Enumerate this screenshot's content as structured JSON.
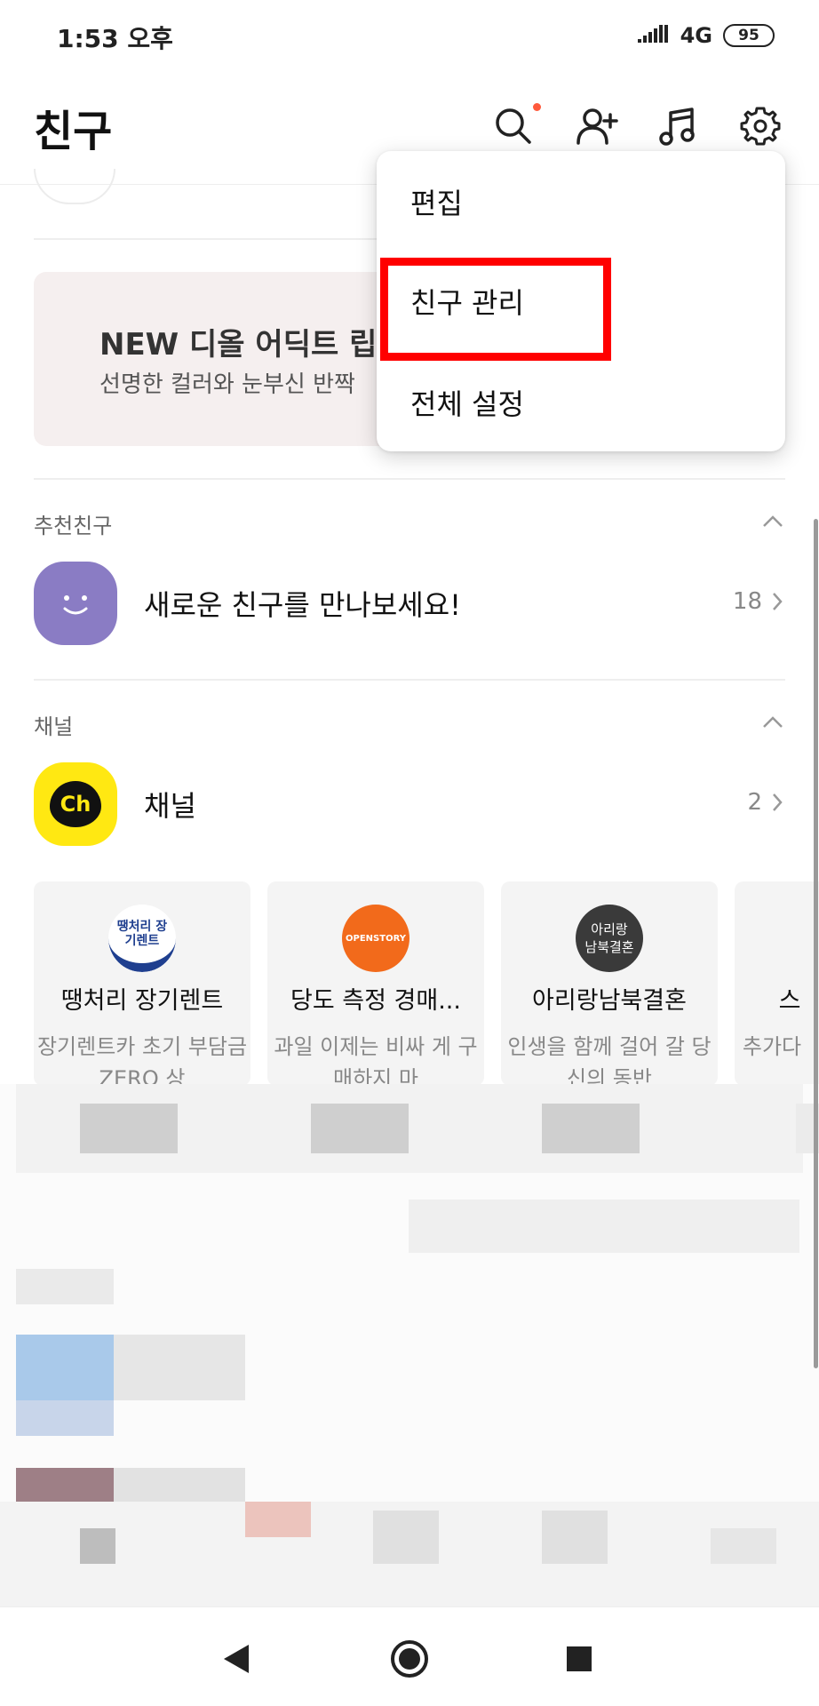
{
  "status_bar": {
    "time": "1:53 오후",
    "network": "4G",
    "battery": "95"
  },
  "header": {
    "title": "친구"
  },
  "banner": {
    "title": "NEW 디올 어딕트 립스",
    "subtitle": "선명한 컬러와 눈부신 반짝"
  },
  "recommended": {
    "section_title": "추천친구",
    "label": "새로운 친구를 만나보세요!",
    "count": "18"
  },
  "channel": {
    "section_title": "채널",
    "label": "채널",
    "count": "2",
    "avatar_text": "Ch"
  },
  "channel_cards": [
    {
      "name": "땡처리 장기렌트",
      "desc": "장기렌트카 초기 부담금 ZERO 상",
      "logo_text": "땡처리 장기렌트"
    },
    {
      "name": "당도 측정 경매...",
      "desc": "과일 이제는 비싸 게 구매하지 마",
      "logo_text": "OPENSTORY"
    },
    {
      "name": "아리랑남북결혼",
      "desc": "인생을 함께 걸어 갈 당신의 동반",
      "logo_text": "아리랑 남북결혼"
    },
    {
      "name": "스",
      "desc": "추가다",
      "logo_text": ""
    }
  ],
  "popup_menu": {
    "items": [
      "편집",
      "친구 관리",
      "전체 설정"
    ],
    "highlighted": "친구 관리"
  },
  "colors": {
    "accent_dot": "#ff5a3c",
    "highlight": "#ff0000",
    "channel_yellow": "#ffe812",
    "friend_purple": "#8a7cc4"
  }
}
